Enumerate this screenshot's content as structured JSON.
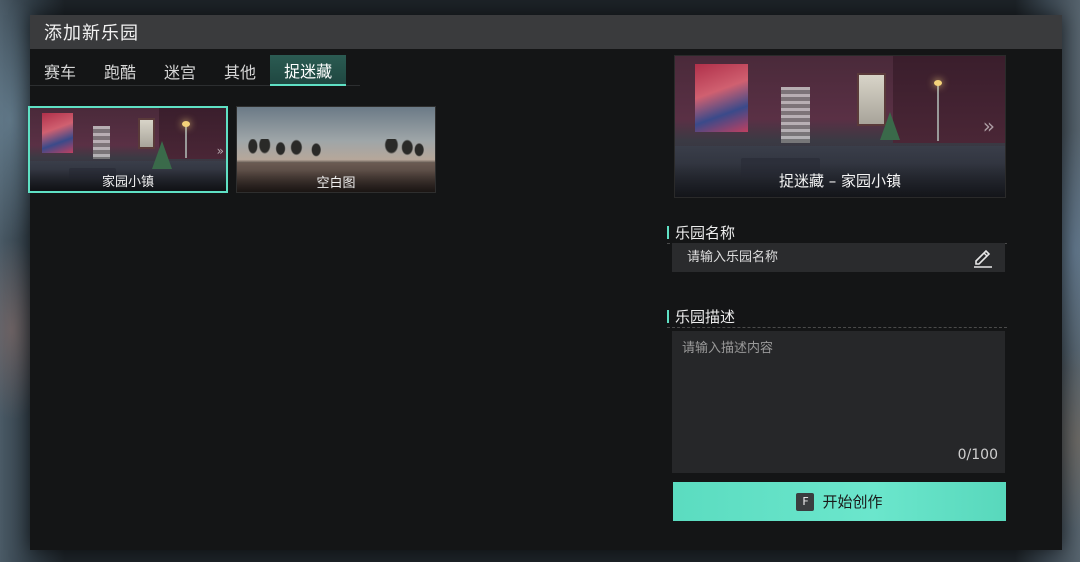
{
  "dialog": {
    "title": "添加新乐园"
  },
  "tabs": [
    {
      "label": "赛车",
      "active": false
    },
    {
      "label": "跑酷",
      "active": false
    },
    {
      "label": "迷宫",
      "active": false
    },
    {
      "label": "其他",
      "active": false
    },
    {
      "label": "捉迷藏",
      "active": true
    }
  ],
  "maps": [
    {
      "label": "家园小镇",
      "selected": true
    },
    {
      "label": "空白图",
      "selected": false
    }
  ],
  "preview": {
    "caption": "捉迷藏 – 家园小镇",
    "chevron": "»"
  },
  "name_section": {
    "label": "乐园名称",
    "placeholder": "请输入乐园名称",
    "value": ""
  },
  "desc_section": {
    "label": "乐园描述",
    "placeholder": "请输入描述内容",
    "value": "",
    "counter": "0/100"
  },
  "start_button": {
    "key": "F",
    "label": "开始创作"
  },
  "colors": {
    "accent": "#5fe0c4",
    "panel": "#141516",
    "titlebar": "#3a3b3d"
  },
  "icons": {
    "edit": "pencil-icon",
    "chevron": "double-chevron-right-icon"
  }
}
